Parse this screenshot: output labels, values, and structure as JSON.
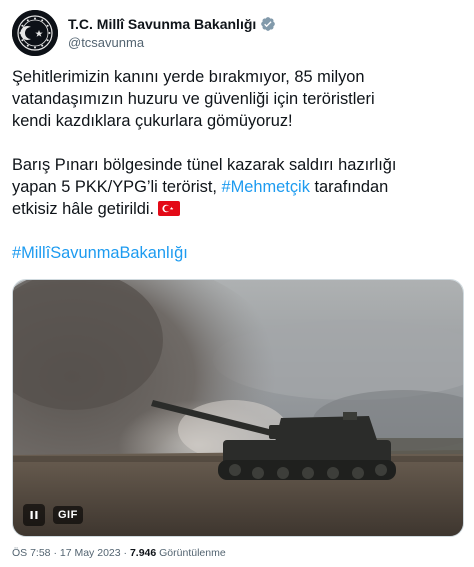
{
  "account": {
    "display_name": "T.C. Millî Savunma Bakanlığı",
    "handle": "@tcsavunma",
    "verified_badge_color": "#829aab"
  },
  "tweet": {
    "paragraph1": [
      "Şehitlerimizin kanını yerde bırakmıyor, 85 milyon",
      "vatandaşımızın huzuru ve güvenliği için teröristleri",
      "kendi kazdıklara çukurlara gömüyoruz!"
    ],
    "paragraph2": {
      "line1": "Barış Pınarı bölgesinde tünel kazarak saldırı hazırlığı",
      "line2_before": "yapan 5 PKK/YPG’li terörist, ",
      "line2_hashtag": "#Mehmetçik",
      "line2_after": " tarafından",
      "line3": "etkisiz hâle getirildi."
    },
    "hashtag_line": "#MillîSavunmaBakanlığı",
    "hashtag_color": "#1d9bf0"
  },
  "media": {
    "type_badge": "GIF",
    "control_icon": "pause-icon"
  },
  "meta": {
    "time": "ÖS 7:58",
    "separator": " · ",
    "date": "17 May 2023",
    "views_count": "7.946",
    "views_label": " Görüntülenme"
  }
}
